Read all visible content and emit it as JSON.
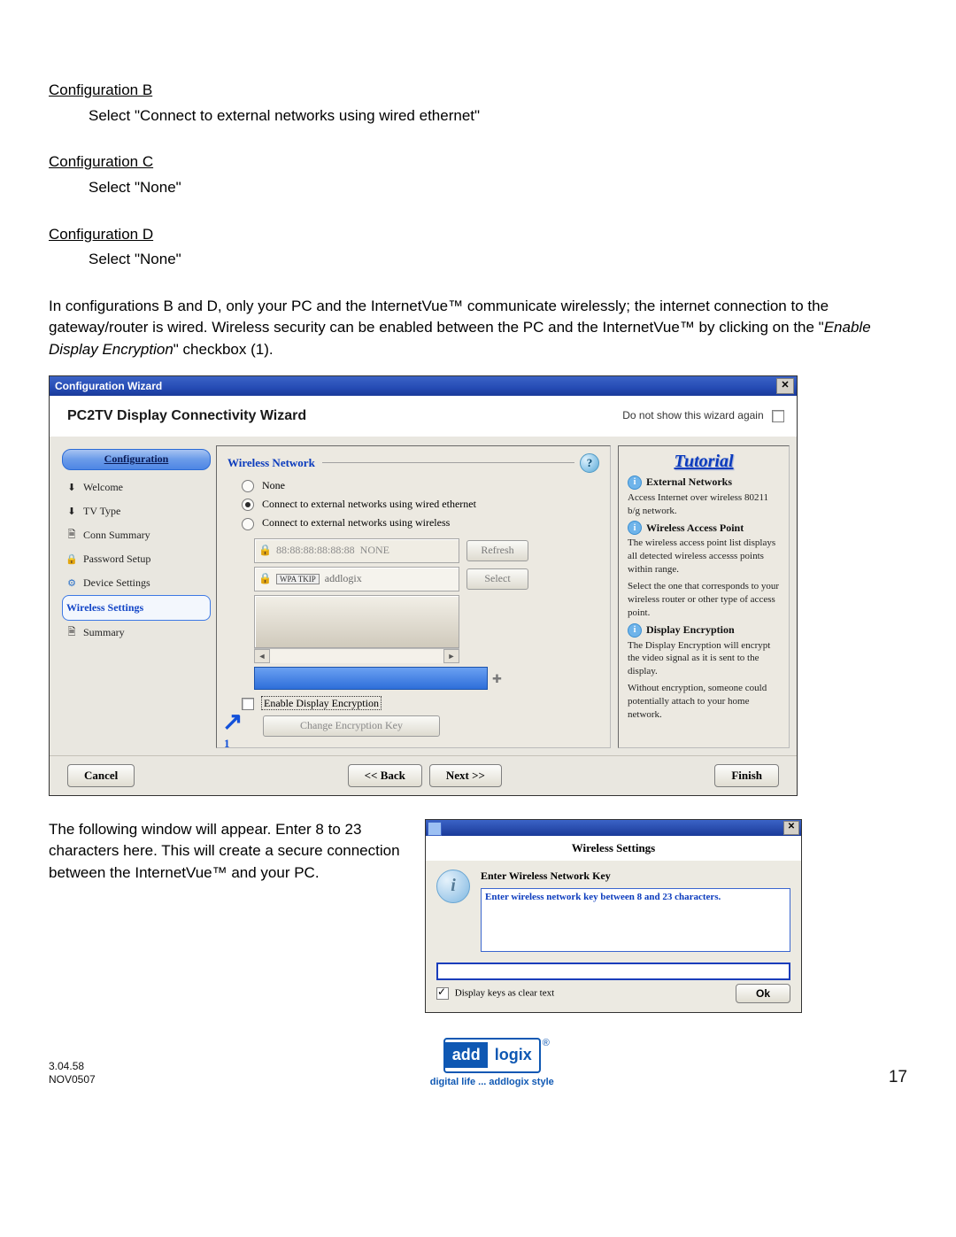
{
  "doc": {
    "cfgB_h": "Configuration B",
    "cfgB_p": "Select \"Connect to external networks using wired ethernet\"",
    "cfgC_h": "Configuration C",
    "cfgC_p": "Select \"None\"",
    "cfgD_h": "Configuration D",
    "cfgD_p": "Select \"None\"",
    "p2a": "In configurations B and D, only your PC and the InternetVue™ communicate wirelessly; the internet connection to the gateway/router is wired.  Wireless security can be enabled between the PC and the InternetVue™ by clicking on the \"",
    "p2b": "Enable Display Encryption",
    "p2c": "\" checkbox (1).",
    "p3": "The following window will appear.  Enter 8 to 23 characters here.  This will create a secure connection between the InternetVue™ and your PC."
  },
  "wizard": {
    "title": "Configuration Wizard",
    "header": "PC2TV Display Connectivity Wizard",
    "dontshow": "Do not show this wizard again",
    "sidebar": {
      "head": "Configuration",
      "items": [
        {
          "label": "Welcome"
        },
        {
          "label": "TV Type"
        },
        {
          "label": "Conn Summary"
        },
        {
          "label": "Password Setup"
        },
        {
          "label": "Device Settings"
        },
        {
          "label": "Wireless Settings"
        },
        {
          "label": "Summary"
        }
      ]
    },
    "center": {
      "section": "Wireless Network",
      "r1": "None",
      "r2": "Connect to external networks using wired ethernet",
      "r3": "Connect to external networks using wireless",
      "net1_mac": "88:88:88:88:88:88",
      "net1_name": "NONE",
      "net2_name": "addlogix",
      "wpa": "WPA TKIP",
      "btn_refresh": "Refresh",
      "btn_select": "Select",
      "enable_enc": "Enable Display Encryption",
      "change_key": "Change Encryption Key",
      "arrow_num": "1"
    },
    "tut": {
      "title": "Tutorial",
      "h1": "External Networks",
      "p1": "Access Internet over wireless 80211 b/g network.",
      "h2": "Wireless Access Point",
      "p2": "The wireless access point list displays all detected wireless accesss points within range.",
      "p2b": "Select the one that corresponds to your wireless router or other type of access point.",
      "h3": "Display Encryption",
      "p3": "The Display Encryption will encrypt the video signal as it is sent to the display.",
      "p3b": "Without encryption, someone could potentially attach to your home network."
    },
    "footer": {
      "cancel": "Cancel",
      "back": "<<  Back",
      "next": "Next  >>",
      "finish": "Finish"
    }
  },
  "keydlg": {
    "title": "Wireless Settings",
    "label": "Enter Wireless Network Key",
    "hint": "Enter wireless network key between 8 and 23 characters.",
    "clear": "Display keys as clear text",
    "ok": "Ok"
  },
  "footer": {
    "ver": "3.04.58",
    "date": "NOV0507",
    "brand1": "add",
    "brand2": "logix",
    "tag": "digital life ... addlogix style",
    "page": "17"
  }
}
